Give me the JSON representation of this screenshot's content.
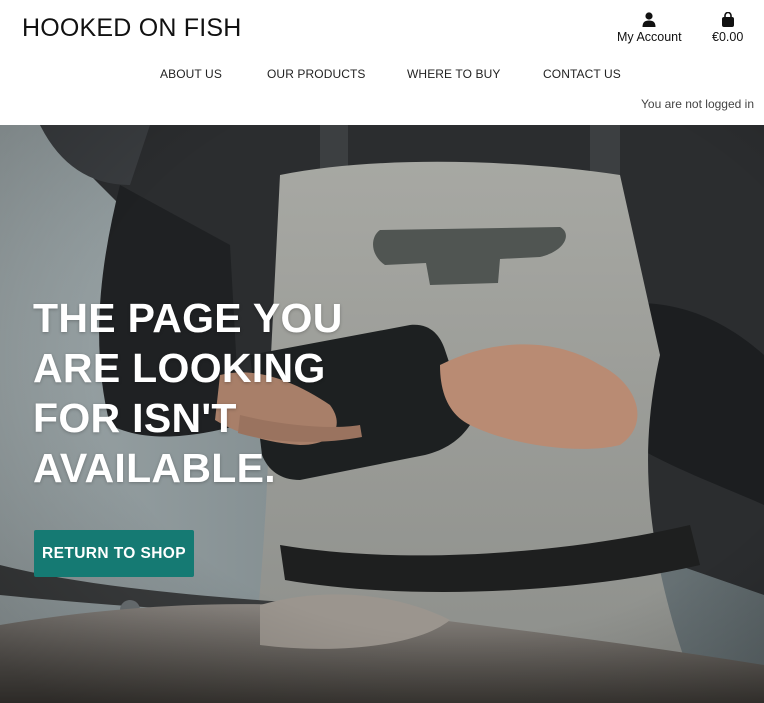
{
  "brand": {
    "title": "HOOKED ON FISH"
  },
  "account": {
    "icon": "user-icon",
    "label": "My Account"
  },
  "bag": {
    "icon": "shopping-bag-icon",
    "total": "€0.00"
  },
  "nav": {
    "items": [
      {
        "label": "ABOUT US"
      },
      {
        "label": "OUR PRODUCTS"
      },
      {
        "label": "WHERE TO BUY"
      },
      {
        "label": "CONTACT US"
      }
    ]
  },
  "status": {
    "login": "You are not logged in"
  },
  "hero": {
    "heading_lines": [
      "THE PAGE YOU",
      "ARE LOOKING",
      "FOR ISN'T",
      "AVAILABLE."
    ],
    "cta_label": "RETURN TO SHOP",
    "accent_color": "#157a73"
  }
}
